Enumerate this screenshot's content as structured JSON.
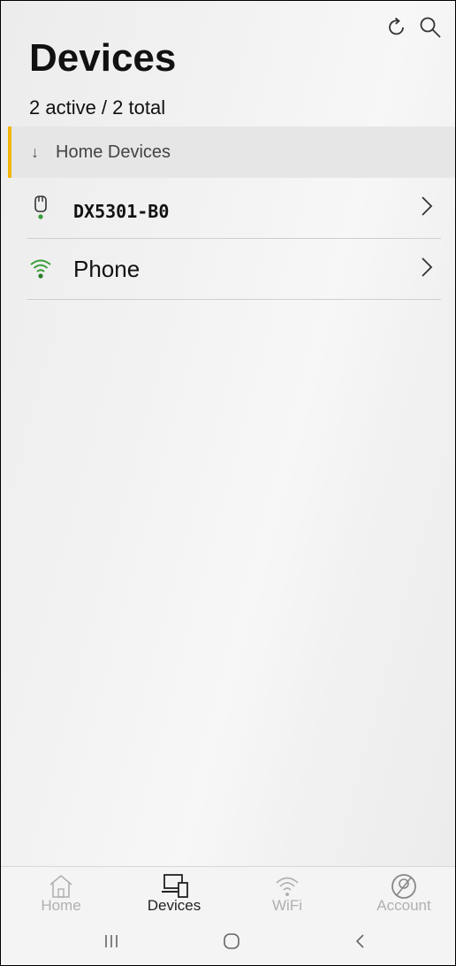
{
  "header": {
    "title": "Devices",
    "subtitle": "2 active / 2 total",
    "icons": [
      "refresh-icon",
      "search-icon"
    ]
  },
  "section": {
    "arrow": "↓",
    "label": "Home Devices",
    "accent": "#f2b600"
  },
  "devices": [
    {
      "name": "DX5301-B0",
      "icon": "router-icon",
      "status_color": "#3a9c3a"
    },
    {
      "name": "Phone",
      "icon": "wifi-icon",
      "status_color": "#3a9c3a"
    }
  ],
  "bottom_nav": {
    "items": [
      {
        "label": "Home",
        "icon": "home-icon",
        "active": false
      },
      {
        "label": "Devices",
        "icon": "devices-icon",
        "active": true
      },
      {
        "label": "WiFi",
        "icon": "wifi-icon",
        "active": false
      },
      {
        "label": "Account",
        "icon": "account-icon",
        "active": false
      }
    ]
  },
  "system_nav": [
    "recents-icon",
    "home-circle-icon",
    "back-icon"
  ]
}
